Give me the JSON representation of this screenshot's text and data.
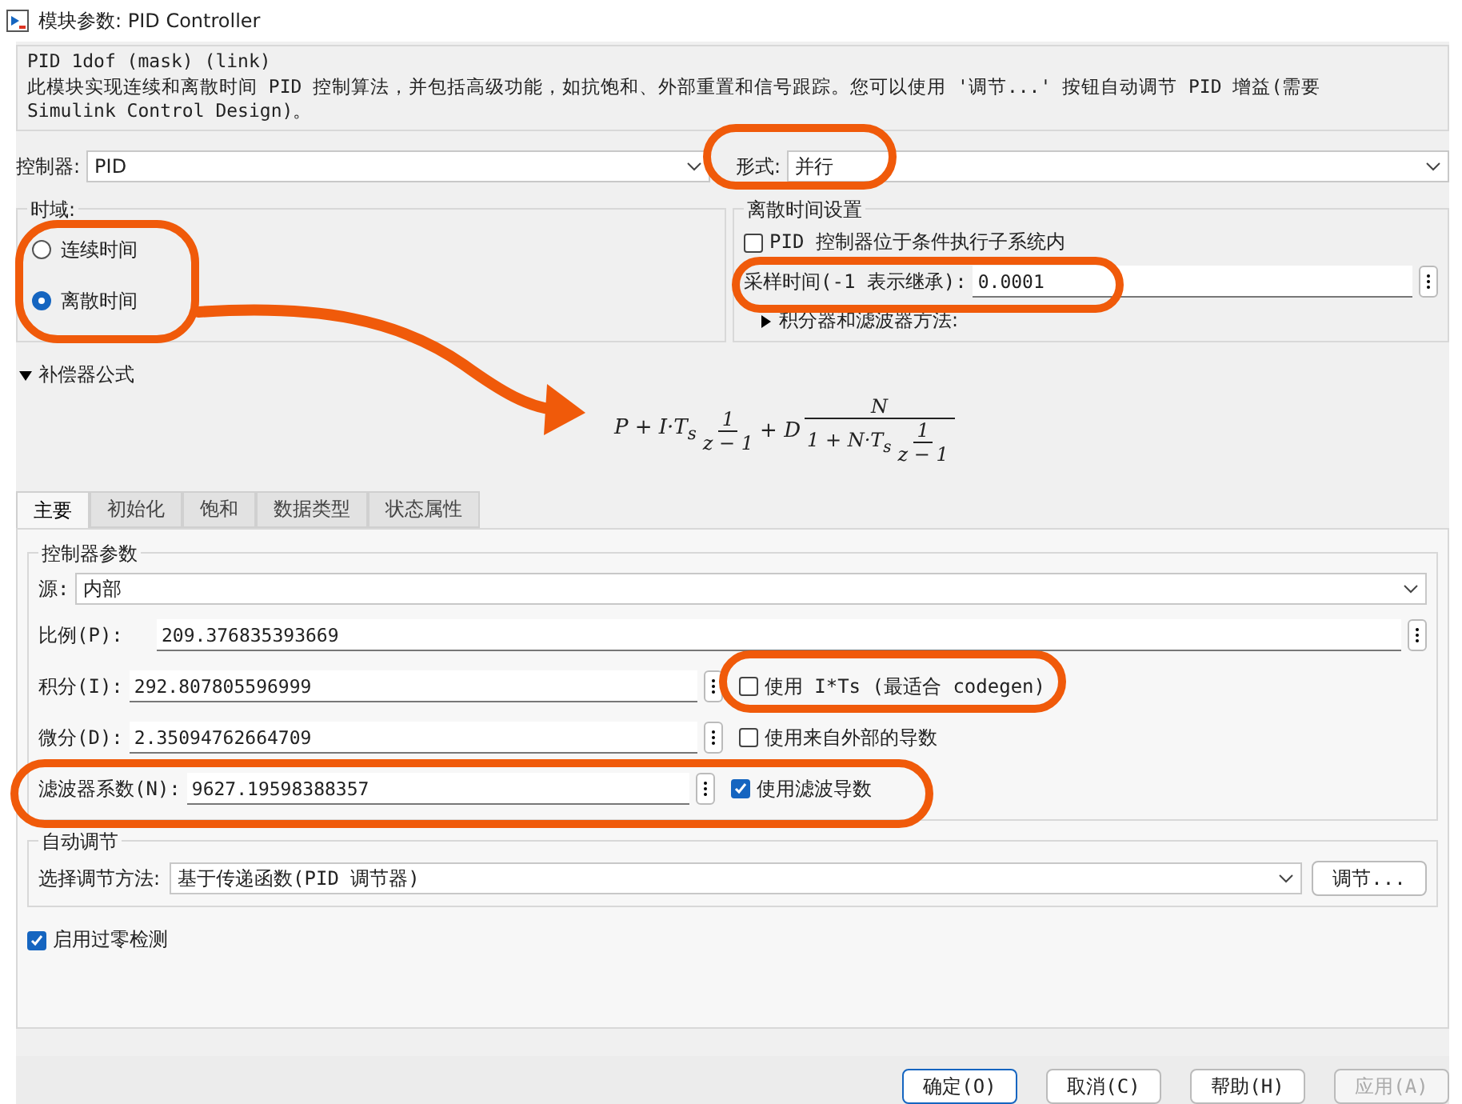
{
  "window": {
    "title": "模块参数: PID Controller"
  },
  "description": {
    "title": "PID 1dof (mask) (link)",
    "text": "此模块实现连续和离散时间 PID 控制算法，并包括高级功能，如抗饱和、外部重置和信号跟踪。您可以使用 '调节...' 按钮自动调节 PID 增益(需要 Simulink Control Design)。"
  },
  "controller": {
    "label": "控制器:",
    "value": "PID"
  },
  "form": {
    "label": "形式:",
    "value": "并行"
  },
  "time_domain": {
    "title": "时域:",
    "options": [
      {
        "label": "连续时间",
        "selected": false
      },
      {
        "label": "离散时间",
        "selected": true
      }
    ]
  },
  "discrete_settings": {
    "title": "离散时间设置",
    "checkbox": {
      "label": "PID 控制器位于条件执行子系统内",
      "checked": false
    },
    "sample_time": {
      "label": "采样时间(-1 表示继承):",
      "value": "0.0001"
    },
    "method": {
      "label": "积分器和滤波器方法:",
      "expanded": false
    }
  },
  "compensator": {
    "label": "补偿器公式",
    "expanded": true,
    "formula": {
      "lead": "P + I·T$_{s}$",
      "frac1": {
        "num": "1",
        "den": "z − 1"
      },
      "mid": "+ D",
      "frac2": {
        "num": "N",
        "den_lead": "1 + N·T$_{s}$",
        "den_num": "1",
        "den_den": "z − 1"
      }
    }
  },
  "tabs": [
    {
      "label": "主要",
      "selected": true
    },
    {
      "label": "初始化",
      "selected": false
    },
    {
      "label": "饱和",
      "selected": false
    },
    {
      "label": "数据类型",
      "selected": false
    },
    {
      "label": "状态属性",
      "selected": false
    }
  ],
  "controller_params": {
    "title": "控制器参数",
    "source": {
      "label": "源:",
      "value": "内部"
    },
    "rows": [
      {
        "label": "比例(P):",
        "value": "209.376835393669"
      },
      {
        "label": "积分(I):",
        "value": "292.807805596999",
        "option": {
          "label": "使用 I*Ts (最适合 codegen)",
          "checked": false
        }
      },
      {
        "label": "微分(D):",
        "value": "2.35094762664709",
        "option": {
          "label": "使用来自外部的导数",
          "checked": false
        }
      },
      {
        "label": "滤波器系数(N):",
        "value": "9627.19598388357",
        "option": {
          "label": "使用滤波导数",
          "checked": true
        }
      }
    ]
  },
  "auto_tune": {
    "title": "自动调节",
    "label": "选择调节方法:",
    "value": "基于传递函数(PID 调节器)",
    "button": "调节..."
  },
  "zero_crossing": {
    "label": "启用过零检测",
    "checked": true
  },
  "buttons": [
    {
      "label": "确定(O)",
      "disabled": false,
      "default": true
    },
    {
      "label": "取消(C)",
      "disabled": false,
      "default": false
    },
    {
      "label": "帮助(H)",
      "disabled": false,
      "default": false
    },
    {
      "label": "应用(A)",
      "disabled": true,
      "default": false
    }
  ],
  "annotations": [
    {
      "kind": "ring"
    },
    {
      "kind": "ring"
    },
    {
      "kind": "arrow"
    },
    {
      "kind": "ring"
    },
    {
      "kind": "ring"
    },
    {
      "kind": "ring"
    }
  ]
}
